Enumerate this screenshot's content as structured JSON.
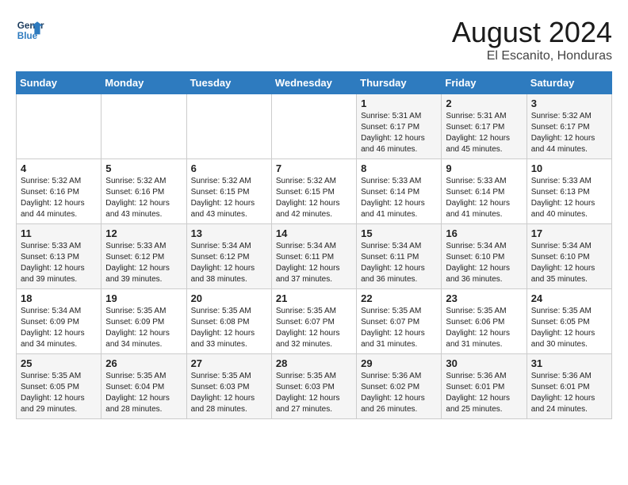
{
  "header": {
    "logo_line1": "General",
    "logo_line2": "Blue",
    "month_year": "August 2024",
    "location": "El Escanito, Honduras"
  },
  "weekdays": [
    "Sunday",
    "Monday",
    "Tuesday",
    "Wednesday",
    "Thursday",
    "Friday",
    "Saturday"
  ],
  "weeks": [
    [
      {
        "day": "",
        "info": ""
      },
      {
        "day": "",
        "info": ""
      },
      {
        "day": "",
        "info": ""
      },
      {
        "day": "",
        "info": ""
      },
      {
        "day": "1",
        "info": "Sunrise: 5:31 AM\nSunset: 6:17 PM\nDaylight: 12 hours\nand 46 minutes."
      },
      {
        "day": "2",
        "info": "Sunrise: 5:31 AM\nSunset: 6:17 PM\nDaylight: 12 hours\nand 45 minutes."
      },
      {
        "day": "3",
        "info": "Sunrise: 5:32 AM\nSunset: 6:17 PM\nDaylight: 12 hours\nand 44 minutes."
      }
    ],
    [
      {
        "day": "4",
        "info": "Sunrise: 5:32 AM\nSunset: 6:16 PM\nDaylight: 12 hours\nand 44 minutes."
      },
      {
        "day": "5",
        "info": "Sunrise: 5:32 AM\nSunset: 6:16 PM\nDaylight: 12 hours\nand 43 minutes."
      },
      {
        "day": "6",
        "info": "Sunrise: 5:32 AM\nSunset: 6:15 PM\nDaylight: 12 hours\nand 43 minutes."
      },
      {
        "day": "7",
        "info": "Sunrise: 5:32 AM\nSunset: 6:15 PM\nDaylight: 12 hours\nand 42 minutes."
      },
      {
        "day": "8",
        "info": "Sunrise: 5:33 AM\nSunset: 6:14 PM\nDaylight: 12 hours\nand 41 minutes."
      },
      {
        "day": "9",
        "info": "Sunrise: 5:33 AM\nSunset: 6:14 PM\nDaylight: 12 hours\nand 41 minutes."
      },
      {
        "day": "10",
        "info": "Sunrise: 5:33 AM\nSunset: 6:13 PM\nDaylight: 12 hours\nand 40 minutes."
      }
    ],
    [
      {
        "day": "11",
        "info": "Sunrise: 5:33 AM\nSunset: 6:13 PM\nDaylight: 12 hours\nand 39 minutes."
      },
      {
        "day": "12",
        "info": "Sunrise: 5:33 AM\nSunset: 6:12 PM\nDaylight: 12 hours\nand 39 minutes."
      },
      {
        "day": "13",
        "info": "Sunrise: 5:34 AM\nSunset: 6:12 PM\nDaylight: 12 hours\nand 38 minutes."
      },
      {
        "day": "14",
        "info": "Sunrise: 5:34 AM\nSunset: 6:11 PM\nDaylight: 12 hours\nand 37 minutes."
      },
      {
        "day": "15",
        "info": "Sunrise: 5:34 AM\nSunset: 6:11 PM\nDaylight: 12 hours\nand 36 minutes."
      },
      {
        "day": "16",
        "info": "Sunrise: 5:34 AM\nSunset: 6:10 PM\nDaylight: 12 hours\nand 36 minutes."
      },
      {
        "day": "17",
        "info": "Sunrise: 5:34 AM\nSunset: 6:10 PM\nDaylight: 12 hours\nand 35 minutes."
      }
    ],
    [
      {
        "day": "18",
        "info": "Sunrise: 5:34 AM\nSunset: 6:09 PM\nDaylight: 12 hours\nand 34 minutes."
      },
      {
        "day": "19",
        "info": "Sunrise: 5:35 AM\nSunset: 6:09 PM\nDaylight: 12 hours\nand 34 minutes."
      },
      {
        "day": "20",
        "info": "Sunrise: 5:35 AM\nSunset: 6:08 PM\nDaylight: 12 hours\nand 33 minutes."
      },
      {
        "day": "21",
        "info": "Sunrise: 5:35 AM\nSunset: 6:07 PM\nDaylight: 12 hours\nand 32 minutes."
      },
      {
        "day": "22",
        "info": "Sunrise: 5:35 AM\nSunset: 6:07 PM\nDaylight: 12 hours\nand 31 minutes."
      },
      {
        "day": "23",
        "info": "Sunrise: 5:35 AM\nSunset: 6:06 PM\nDaylight: 12 hours\nand 31 minutes."
      },
      {
        "day": "24",
        "info": "Sunrise: 5:35 AM\nSunset: 6:05 PM\nDaylight: 12 hours\nand 30 minutes."
      }
    ],
    [
      {
        "day": "25",
        "info": "Sunrise: 5:35 AM\nSunset: 6:05 PM\nDaylight: 12 hours\nand 29 minutes."
      },
      {
        "day": "26",
        "info": "Sunrise: 5:35 AM\nSunset: 6:04 PM\nDaylight: 12 hours\nand 28 minutes."
      },
      {
        "day": "27",
        "info": "Sunrise: 5:35 AM\nSunset: 6:03 PM\nDaylight: 12 hours\nand 28 minutes."
      },
      {
        "day": "28",
        "info": "Sunrise: 5:35 AM\nSunset: 6:03 PM\nDaylight: 12 hours\nand 27 minutes."
      },
      {
        "day": "29",
        "info": "Sunrise: 5:36 AM\nSunset: 6:02 PM\nDaylight: 12 hours\nand 26 minutes."
      },
      {
        "day": "30",
        "info": "Sunrise: 5:36 AM\nSunset: 6:01 PM\nDaylight: 12 hours\nand 25 minutes."
      },
      {
        "day": "31",
        "info": "Sunrise: 5:36 AM\nSunset: 6:01 PM\nDaylight: 12 hours\nand 24 minutes."
      }
    ]
  ]
}
